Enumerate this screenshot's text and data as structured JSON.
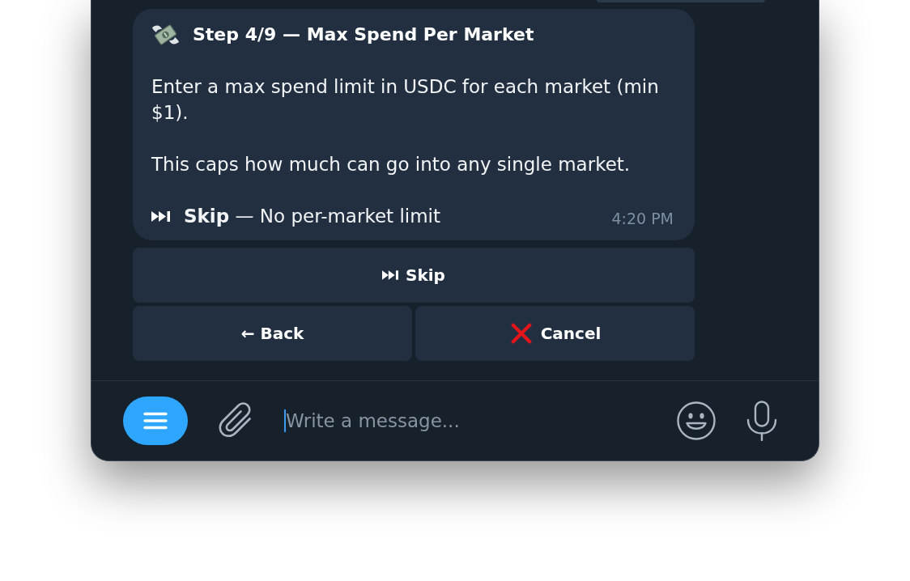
{
  "message": {
    "title": "Step 4/9 — Max Spend Per Market",
    "paragraphs": [
      "Enter a max spend limit in USDC for each market (min $1).",
      "This caps how much can go into any single market.",
      "**Skip** — No per-market limit"
    ],
    "time": "4:20 PM"
  },
  "keyboard": [
    [
      {
        "label": "Skip"
      }
    ],
    [
      {
        "label": "← Back"
      },
      {
        "label": "Cancel"
      }
    ]
  ],
  "composer": {
    "placeholder": "Write a message...",
    "focused": true
  }
}
